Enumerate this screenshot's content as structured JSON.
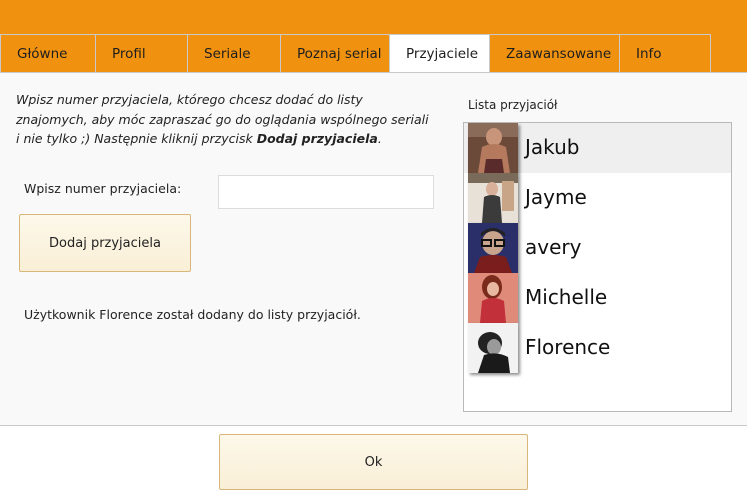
{
  "tabs": [
    {
      "label": "Główne"
    },
    {
      "label": "Profil"
    },
    {
      "label": "Seriale"
    },
    {
      "label": "Poznaj serial"
    },
    {
      "label": "Przyjaciele",
      "active": true
    },
    {
      "label": "Zaawansowane"
    },
    {
      "label": "Info"
    }
  ],
  "instructions": {
    "text": "Wpisz numer przyjaciela, którego chcesz dodać do listy znajomych, aby móc zapraszać go do oglądania wspólnego seriali i nie tylko ;) Następnie kliknij przycisk ",
    "button_ref": "Dodaj przyjaciela",
    "end": "."
  },
  "form": {
    "number_label": "Wpisz numer przyjaciela:",
    "number_value": "",
    "add_button_label": "Dodaj przyjaciela"
  },
  "status_message": "Użytkownik Florence został dodany do listy przyjaciół.",
  "friends_list": {
    "label": "Lista przyjaciół",
    "items": [
      {
        "name": "Jakub",
        "selected": true
      },
      {
        "name": "Jayme"
      },
      {
        "name": "avery"
      },
      {
        "name": "Michelle"
      },
      {
        "name": "Florence"
      }
    ]
  },
  "ok_button_label": "Ok",
  "colors": {
    "accent": "#f0920f",
    "button_fill": "#fbf3e0",
    "button_border": "#d9b77a"
  }
}
